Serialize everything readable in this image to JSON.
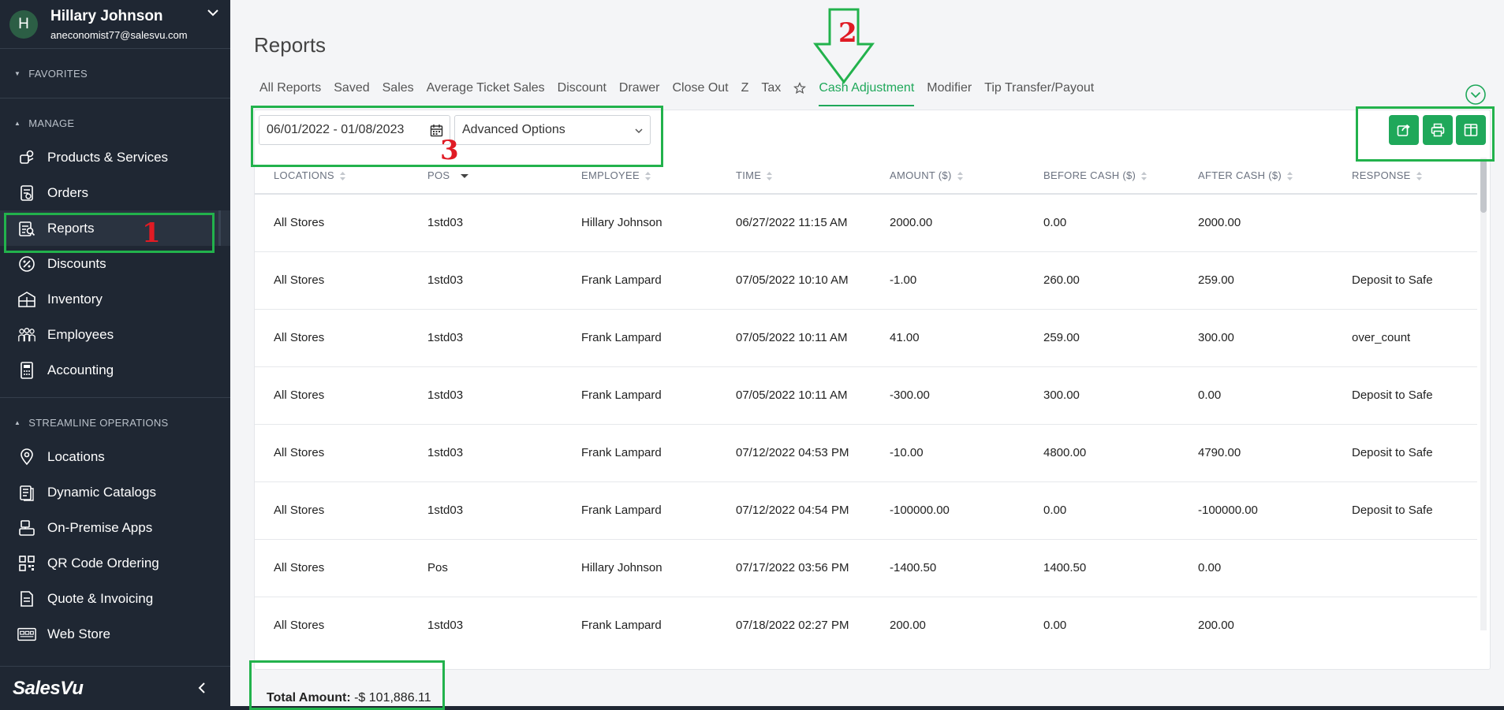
{
  "user": {
    "initial": "H",
    "name": "Hillary Johnson",
    "email": "aneconomist77@salesvu.com"
  },
  "sidebar": {
    "favorites_label": "FAVORITES",
    "manage_label": "MANAGE",
    "streamline_label": "STREAMLINE OPERATIONS",
    "manage_items": [
      {
        "label": "Products & Services",
        "icon": "products-icon"
      },
      {
        "label": "Orders",
        "icon": "orders-icon"
      },
      {
        "label": "Reports",
        "icon": "reports-icon"
      },
      {
        "label": "Discounts",
        "icon": "discount-icon"
      },
      {
        "label": "Inventory",
        "icon": "inventory-icon"
      },
      {
        "label": "Employees",
        "icon": "employees-icon"
      },
      {
        "label": "Accounting",
        "icon": "calculator-icon"
      }
    ],
    "streamline_items": [
      {
        "label": "Locations",
        "icon": "location-pin-icon"
      },
      {
        "label": "Dynamic Catalogs",
        "icon": "catalog-icon"
      },
      {
        "label": "On-Premise Apps",
        "icon": "pos-terminal-icon"
      },
      {
        "label": "QR Code Ordering",
        "icon": "qr-code-icon"
      },
      {
        "label": "Quote & Invoicing",
        "icon": "invoice-icon"
      },
      {
        "label": "Web Store",
        "icon": "web-store-icon"
      }
    ],
    "brand": "SalesVu"
  },
  "page": {
    "title": "Reports",
    "tabs": [
      "All Reports",
      "Saved",
      "Sales",
      "Average Ticket Sales",
      "Discount",
      "Drawer",
      "Close Out",
      "Z",
      "Tax",
      "Cash Adjustment",
      "Modifier",
      "Tip Transfer/Payout"
    ],
    "active_tab": "Cash Adjustment"
  },
  "filters": {
    "date_range": "06/01/2022 - 01/08/2023",
    "advanced": "Advanced Options"
  },
  "table": {
    "columns": [
      "LOCATIONS",
      "POS",
      "EMPLOYEE",
      "TIME",
      "AMOUNT ($)",
      "BEFORE CASH ($)",
      "AFTER CASH ($)",
      "RESPONSE"
    ],
    "rows": [
      {
        "location": "All Stores",
        "pos": "1std03",
        "employee": "Hillary Johnson",
        "time": "06/27/2022 11:15 AM",
        "amount": "2000.00",
        "before": "0.00",
        "after": "2000.00",
        "response": ""
      },
      {
        "location": "All Stores",
        "pos": "1std03",
        "employee": "Frank Lampard",
        "time": "07/05/2022 10:10 AM",
        "amount": "-1.00",
        "before": "260.00",
        "after": "259.00",
        "response": "Deposit to Safe"
      },
      {
        "location": "All Stores",
        "pos": "1std03",
        "employee": "Frank Lampard",
        "time": "07/05/2022 10:11 AM",
        "amount": "41.00",
        "before": "259.00",
        "after": "300.00",
        "response": "over_count"
      },
      {
        "location": "All Stores",
        "pos": "1std03",
        "employee": "Frank Lampard",
        "time": "07/05/2022 10:11 AM",
        "amount": "-300.00",
        "before": "300.00",
        "after": "0.00",
        "response": "Deposit to Safe"
      },
      {
        "location": "All Stores",
        "pos": "1std03",
        "employee": "Frank Lampard",
        "time": "07/12/2022 04:53 PM",
        "amount": "-10.00",
        "before": "4800.00",
        "after": "4790.00",
        "response": "Deposit to Safe"
      },
      {
        "location": "All Stores",
        "pos": "1std03",
        "employee": "Frank Lampard",
        "time": "07/12/2022 04:54 PM",
        "amount": "-100000.00",
        "before": "0.00",
        "after": "-100000.00",
        "response": "Deposit to Safe"
      },
      {
        "location": "All Stores",
        "pos": "Pos",
        "employee": "Hillary Johnson",
        "time": "07/17/2022 03:56 PM",
        "amount": "-1400.50",
        "before": "1400.50",
        "after": "0.00",
        "response": ""
      },
      {
        "location": "All Stores",
        "pos": "1std03",
        "employee": "Frank Lampard",
        "time": "07/18/2022 02:27 PM",
        "amount": "200.00",
        "before": "0.00",
        "after": "200.00",
        "response": ""
      }
    ]
  },
  "total": {
    "label": "Total Amount:",
    "value": "-$ 101,886.11"
  },
  "annotations": [
    "1",
    "2",
    "3"
  ],
  "colors": {
    "accent": "#1fa85a",
    "sidebar_bg": "#1f2733",
    "annotation_box": "#22b24c",
    "annotation_number": "#e01b24"
  }
}
